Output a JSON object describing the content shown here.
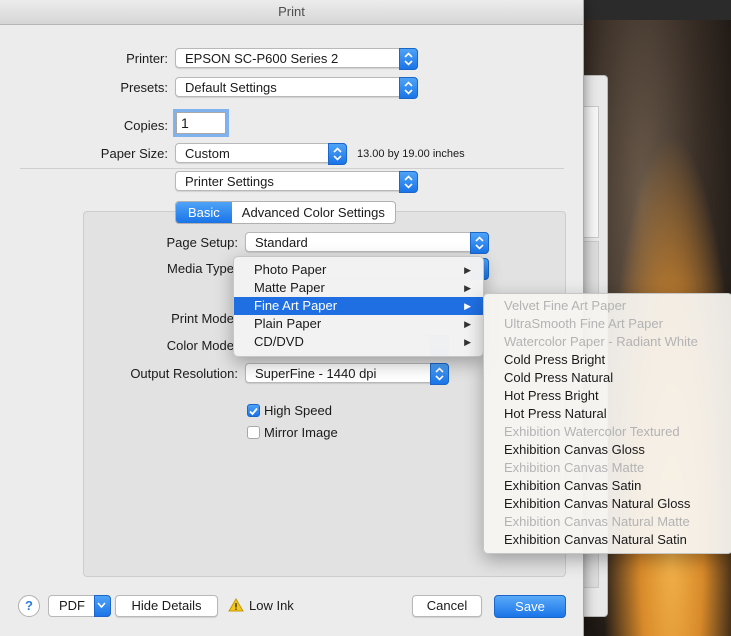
{
  "window": {
    "title": "Print"
  },
  "printer": {
    "label": "Printer:",
    "value": "EPSON SC-P600 Series 2"
  },
  "presets": {
    "label": "Presets:",
    "value": "Default Settings"
  },
  "copies": {
    "label": "Copies:",
    "value": "1"
  },
  "paper_size": {
    "label": "Paper Size:",
    "value": "Custom",
    "dimensions": "13.00 by 19.00 inches"
  },
  "panel_select": {
    "value": "Printer Settings"
  },
  "tabs": [
    {
      "label": "Basic",
      "active": true
    },
    {
      "label": "Advanced Color Settings",
      "active": false
    }
  ],
  "page_setup": {
    "label": "Page Setup:",
    "value": "Standard"
  },
  "media_type": {
    "label": "Media Type"
  },
  "print_mode": {
    "label": "Print Mode"
  },
  "color_mode": {
    "label": "Color Mode"
  },
  "output_resolution": {
    "label": "Output Resolution:",
    "value": "SuperFine - 1440 dpi"
  },
  "checkboxes": [
    {
      "label": "High Speed",
      "checked": true
    },
    {
      "label": "Mirror Image",
      "checked": false
    }
  ],
  "media_menu": {
    "items": [
      {
        "label": "Photo Paper",
        "selected": false
      },
      {
        "label": "Matte Paper",
        "selected": false
      },
      {
        "label": "Fine Art Paper",
        "selected": true
      },
      {
        "label": "Plain Paper",
        "selected": false
      },
      {
        "label": "CD/DVD",
        "selected": false
      }
    ]
  },
  "fine_art_submenu": {
    "items": [
      {
        "label": "Velvet Fine Art Paper",
        "enabled": false
      },
      {
        "label": "UltraSmooth Fine Art Paper",
        "enabled": false
      },
      {
        "label": "Watercolor Paper - Radiant White",
        "enabled": false
      },
      {
        "label": "Cold Press Bright",
        "enabled": true
      },
      {
        "label": "Cold Press Natural",
        "enabled": true
      },
      {
        "label": "Hot Press Bright",
        "enabled": true
      },
      {
        "label": "Hot Press Natural",
        "enabled": true
      },
      {
        "label": "Exhibition Watercolor Textured",
        "enabled": false
      },
      {
        "label": "Exhibition Canvas Gloss",
        "enabled": true
      },
      {
        "label": "Exhibition Canvas Matte",
        "enabled": false
      },
      {
        "label": "Exhibition Canvas Satin",
        "enabled": true
      },
      {
        "label": "Exhibition Canvas Natural Gloss",
        "enabled": true
      },
      {
        "label": "Exhibition Canvas Natural Matte",
        "enabled": false
      },
      {
        "label": "Exhibition Canvas Natural Satin",
        "enabled": true
      }
    ]
  },
  "bottom_bar": {
    "help_label": "?",
    "pdf_label": "PDF",
    "hide_details_label": "Hide Details",
    "warning_label": "Low Ink",
    "cancel_label": "Cancel",
    "save_label": "Save"
  },
  "colors": {
    "accent": "#1f6fe3",
    "disabled_text": "#b3b3b3",
    "dialog_bg": "#ececec"
  }
}
